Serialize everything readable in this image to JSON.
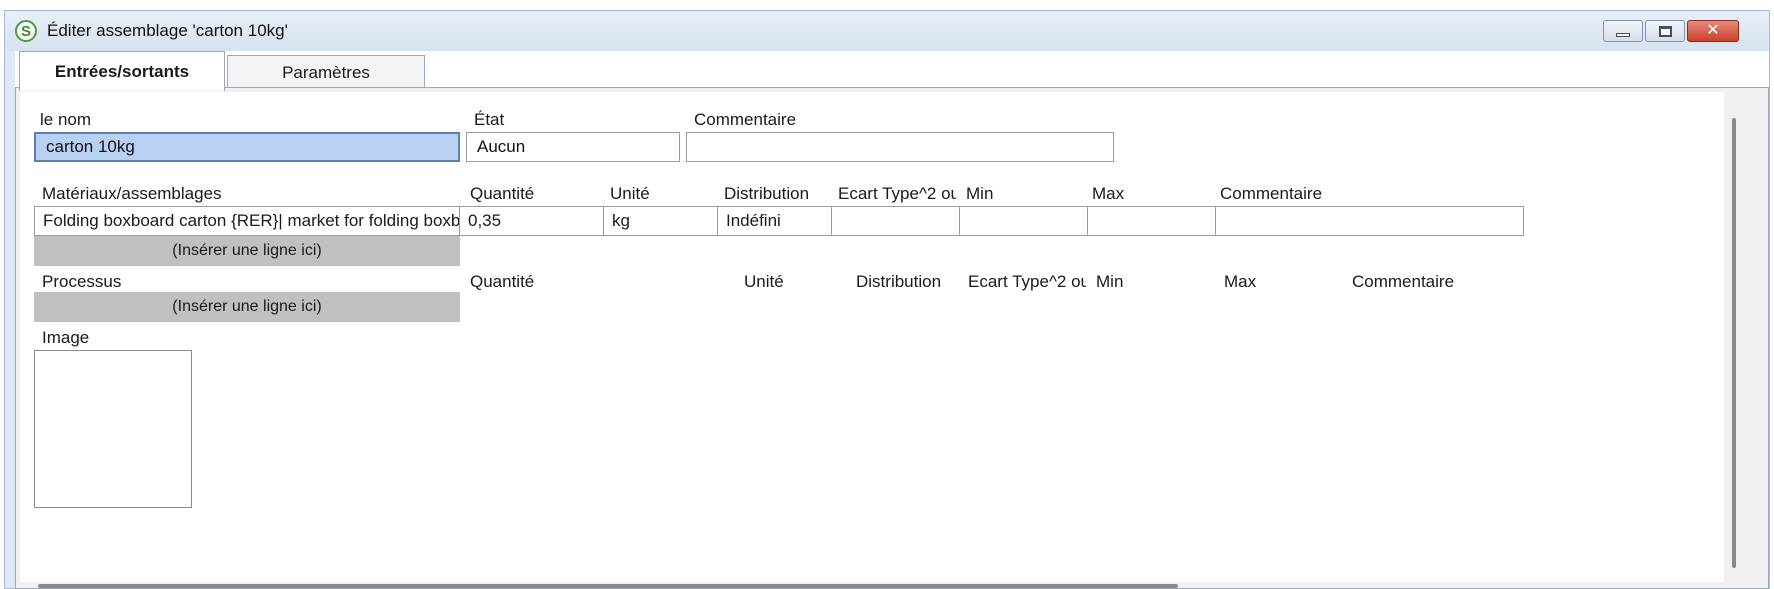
{
  "window": {
    "app_icon_letter": "S",
    "title": "Éditer assemblage 'carton 10kg'",
    "close_glyph": "✕",
    "colors": {
      "titlebar": "#dfe8f3",
      "close_button": "#c9412b",
      "selected_field": "#b9d1f0",
      "insert_bar": "#c0c0c0"
    }
  },
  "tabs": [
    {
      "label": "Entrées/sortants",
      "active": true
    },
    {
      "label": "Paramètres",
      "active": false
    }
  ],
  "form": {
    "name_label": "le nom",
    "name_value": "carton 10kg",
    "state_label": "État",
    "state_value": "Aucun",
    "comment_label": "Commentaire",
    "comment_value": ""
  },
  "materials": {
    "section_label": "Matériaux/assemblages",
    "columns": [
      "Quantité",
      "Unité",
      "Distribution",
      "Ecart Type^2 ou",
      "Min",
      "Max",
      "Commentaire"
    ],
    "rows": [
      {
        "name": "Folding boxboard carton {RER}| market for folding boxboard",
        "quantity": "0,35",
        "unit": "kg",
        "distribution": "Indéfini",
        "std": "",
        "min": "",
        "max": "",
        "comment": ""
      }
    ],
    "insert_label": "(Insérer une ligne ici)"
  },
  "processes": {
    "section_label": "Processus",
    "columns": [
      "Quantité",
      "Unité",
      "Distribution",
      "Ecart Type^2 ou",
      "Min",
      "Max",
      "Commentaire"
    ],
    "insert_label": "(Insérer une ligne ici)"
  },
  "image": {
    "label": "Image"
  },
  "icons": [
    "app-logo-icon",
    "minimize-icon",
    "maximize-icon",
    "close-icon"
  ]
}
